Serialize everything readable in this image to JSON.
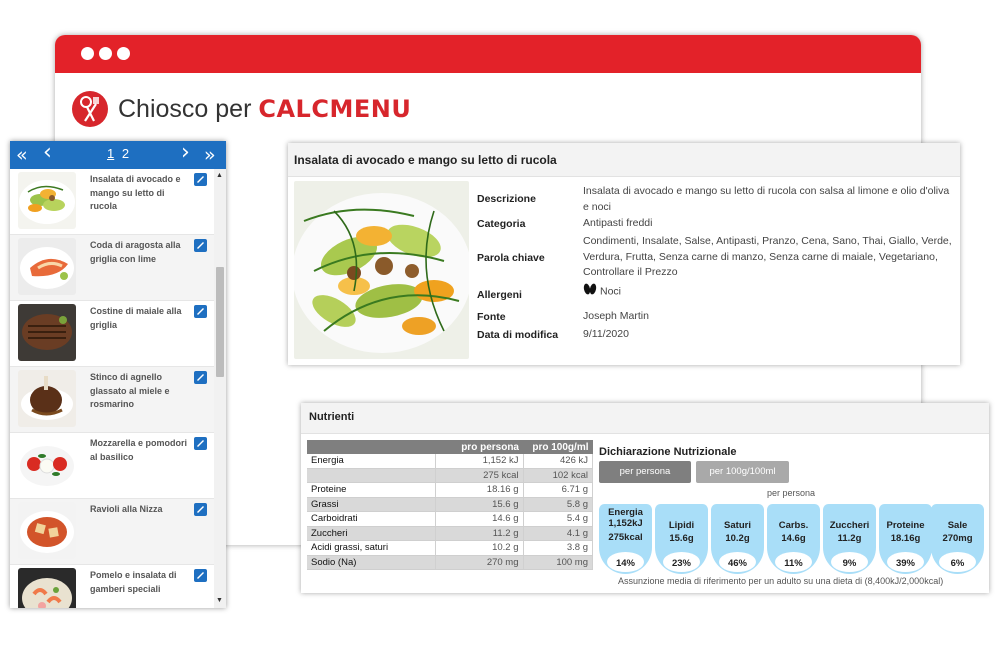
{
  "app": {
    "name_prefix": "Chiosco per",
    "name_brand": "CALCMENU"
  },
  "pager": {
    "first": "«",
    "prev": "‹",
    "next": "›",
    "last": "»",
    "pages": [
      "1",
      "2"
    ],
    "current_page": "1"
  },
  "recipes": [
    {
      "label": "Insalata di avocado e mango su letto di rucola"
    },
    {
      "label": "Coda di aragosta alla griglia con lime"
    },
    {
      "label": "Costine di maiale alla griglia"
    },
    {
      "label": "Stinco di agnello glassato al miele e rosmarino"
    },
    {
      "label": "Mozzarella e pomodori al basilico"
    },
    {
      "label": "Ravioli alla Nizza"
    },
    {
      "label": "Pomelo e insalata di gamberi speciali"
    }
  ],
  "detail": {
    "title": "Insalata di avocado e mango su letto di rucola",
    "labels": {
      "description": "Descrizione",
      "category": "Categoria",
      "keyword": "Parola chiave",
      "allergens": "Allergeni",
      "source": "Fonte",
      "modified": "Data di modifica"
    },
    "description": "Insalata di avocado e mango su letto di rucola con salsa al limone e olio d'oliva e noci",
    "category": "Antipasti freddi",
    "keywords": "Condimenti, Insalate, Salse, Antipasti, Pranzo, Cena, Sano, Thai, Giallo, Verde, Verdura, Frutta, Senza carne di manzo, Senza carne di maiale, Vegetariano, Controllare il Prezzo",
    "allergen": "Noci",
    "source": "Joseph Martin",
    "modified": "9/11/2020"
  },
  "nutrients": {
    "title": "Nutrienti",
    "columns": [
      "",
      "pro persona",
      "pro 100g/ml"
    ],
    "rows": [
      {
        "name": "Energia",
        "per_person": "1,152 kJ",
        "per_100": "426 kJ",
        "shade": false
      },
      {
        "name": "",
        "per_person": "275 kcal",
        "per_100": "102 kcal",
        "shade": true
      },
      {
        "name": "Proteine",
        "per_person": "18.16 g",
        "per_100": "6.71 g",
        "shade": false
      },
      {
        "name": "Grassi",
        "per_person": "15.6 g",
        "per_100": "5.8 g",
        "shade": true
      },
      {
        "name": "Carboidrati",
        "per_person": "14.6 g",
        "per_100": "5.4 g",
        "shade": false
      },
      {
        "name": "Zuccheri",
        "per_person": "11.2 g",
        "per_100": "4.1 g",
        "shade": true
      },
      {
        "name": "Acidi grassi, saturi",
        "per_person": "10.2 g",
        "per_100": "3.8 g",
        "shade": false
      },
      {
        "name": "Sodio (Na)",
        "per_person": "270 mg",
        "per_100": "100 mg",
        "shade": true
      }
    ],
    "declaration": {
      "title": "Dichiarazione Nutrizionale",
      "tab_person": "per persona",
      "tab_100": "per 100g/100ml",
      "subtitle": "per persona",
      "energy": {
        "name": "Energia",
        "kj": "1,152kJ",
        "kcal": "275kcal",
        "pct": "14%"
      },
      "items": [
        {
          "name": "Lipidi",
          "value": "15.6g",
          "pct": "23%"
        },
        {
          "name": "Saturi",
          "value": "10.2g",
          "pct": "46%"
        },
        {
          "name": "Carbs.",
          "value": "14.6g",
          "pct": "11%"
        },
        {
          "name": "Zuccheri",
          "value": "11.2g",
          "pct": "9%"
        },
        {
          "name": "Proteine",
          "value": "18.16g",
          "pct": "39%"
        },
        {
          "name": "Sale",
          "value": "270mg",
          "pct": "6%"
        }
      ],
      "reference": "Assunzione media di riferimento per un adulto su una dieta di (8,400kJ/2,000kcal)"
    }
  },
  "colors": {
    "brand_red": "#e32229",
    "pager_blue": "#1e6fc1",
    "gda_blue": "#a9def8"
  }
}
